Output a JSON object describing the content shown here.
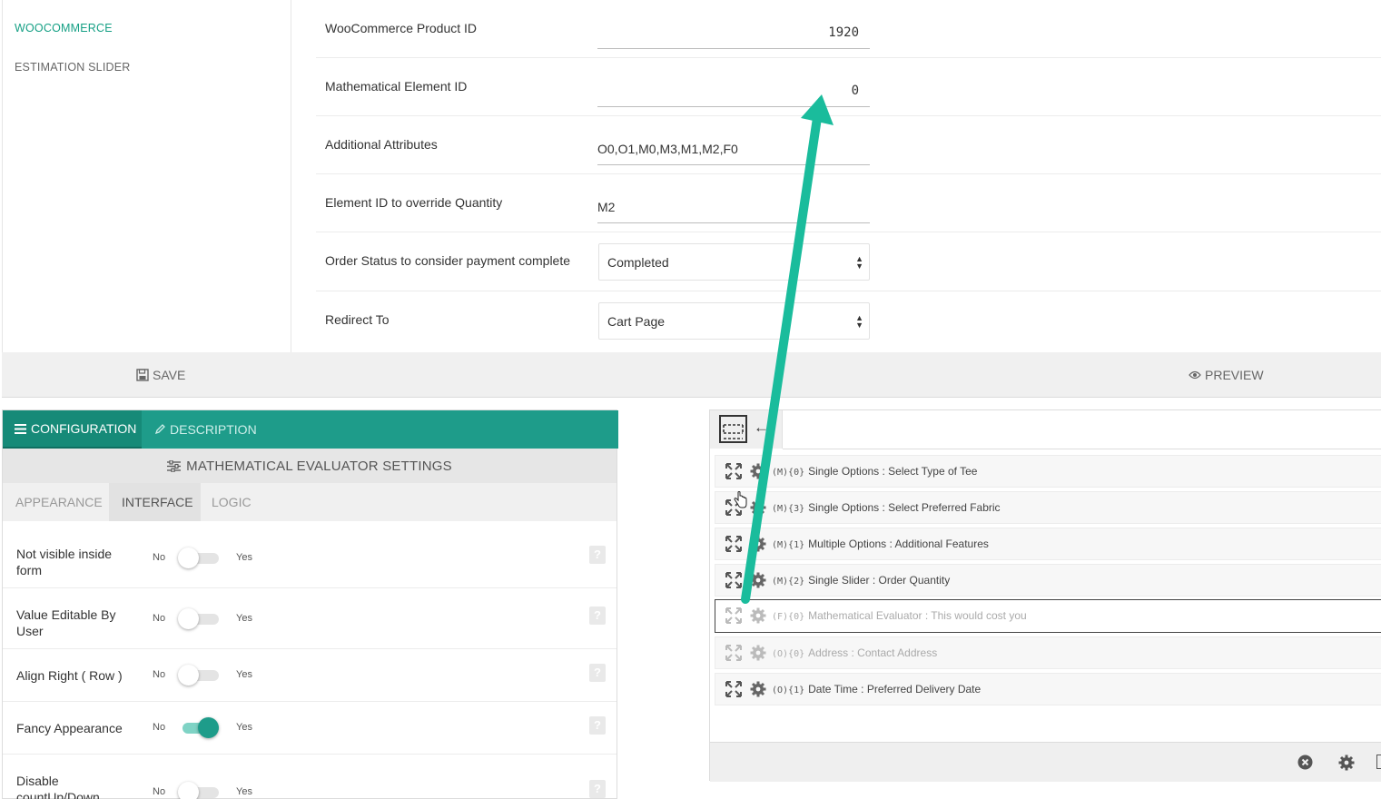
{
  "colors": {
    "accent": "#1e9c8a",
    "accent_dark": "#168a78",
    "annotation_arrow": "#1abc9c"
  },
  "sidebar": {
    "items": [
      {
        "label": "WOOCOMMERCE",
        "active": true
      },
      {
        "label": "ESTIMATION SLIDER",
        "active": false
      }
    ]
  },
  "form": {
    "product_id": {
      "label": "WooCommerce Product ID",
      "value": "1920"
    },
    "math_element": {
      "label": "Mathematical Element ID",
      "value": "0"
    },
    "attributes": {
      "label": "Additional Attributes",
      "value": "O0,O1,M0,M3,M1,M2,F0"
    },
    "qty_override": {
      "label": "Element ID to override Quantity",
      "value": "M2"
    },
    "order_status": {
      "label": "Order Status to consider payment complete",
      "value": "Completed"
    },
    "redirect": {
      "label": "Redirect To",
      "value": "Cart Page"
    }
  },
  "actions": {
    "save_label": "SAVE",
    "preview_label": "PREVIEW"
  },
  "config": {
    "tab_configuration": "CONFIGURATION",
    "tab_description": "DESCRIPTION",
    "settings_title": "MATHEMATICAL EVALUATOR SETTINGS",
    "subtabs": [
      "APPEARANCE",
      "INTERFACE",
      "LOGIC"
    ],
    "active_subtab": "INTERFACE",
    "toggle_no": "No",
    "toggle_yes": "Yes",
    "help_glyph": "?",
    "options": [
      {
        "label": "Not visible inside form",
        "on": false
      },
      {
        "label": "Value Editable By User",
        "on": false
      },
      {
        "label": "Align Right ( Row )",
        "on": false
      },
      {
        "label": "Fancy Appearance",
        "on": true
      },
      {
        "label": "Disable countUp/Down",
        "on": false
      }
    ]
  },
  "elements": {
    "items": [
      {
        "code": "(M){0}",
        "label": "Single Options : Select Type of Tee",
        "state": "normal"
      },
      {
        "code": "(M){3}",
        "label": "Single Options : Select Preferred Fabric",
        "state": "normal"
      },
      {
        "code": "(M){1}",
        "label": "Multiple Options : Additional Features",
        "state": "normal"
      },
      {
        "code": "(M){2}",
        "label": "Single Slider : Order Quantity",
        "state": "normal"
      },
      {
        "code": "(F){0}",
        "label": "Mathematical Evaluator : This would cost you",
        "state": "selected"
      },
      {
        "code": "(O){0}",
        "label": "Address : Contact Address",
        "state": "muted"
      },
      {
        "code": "(O){1}",
        "label": "Date Time : Preferred Delivery Date",
        "state": "normal"
      }
    ]
  },
  "icons": {
    "save": "floppy-disk-icon",
    "preview": "eye-icon",
    "configuration": "list-icon",
    "description": "pencil-icon",
    "settings": "sliders-icon",
    "expand": "expand-icon",
    "gear": "gear-icon",
    "close": "close-circle-icon",
    "layout": "layout-grid-icon",
    "back": "arrow-left-icon",
    "cursor": "hand-cursor-icon"
  }
}
